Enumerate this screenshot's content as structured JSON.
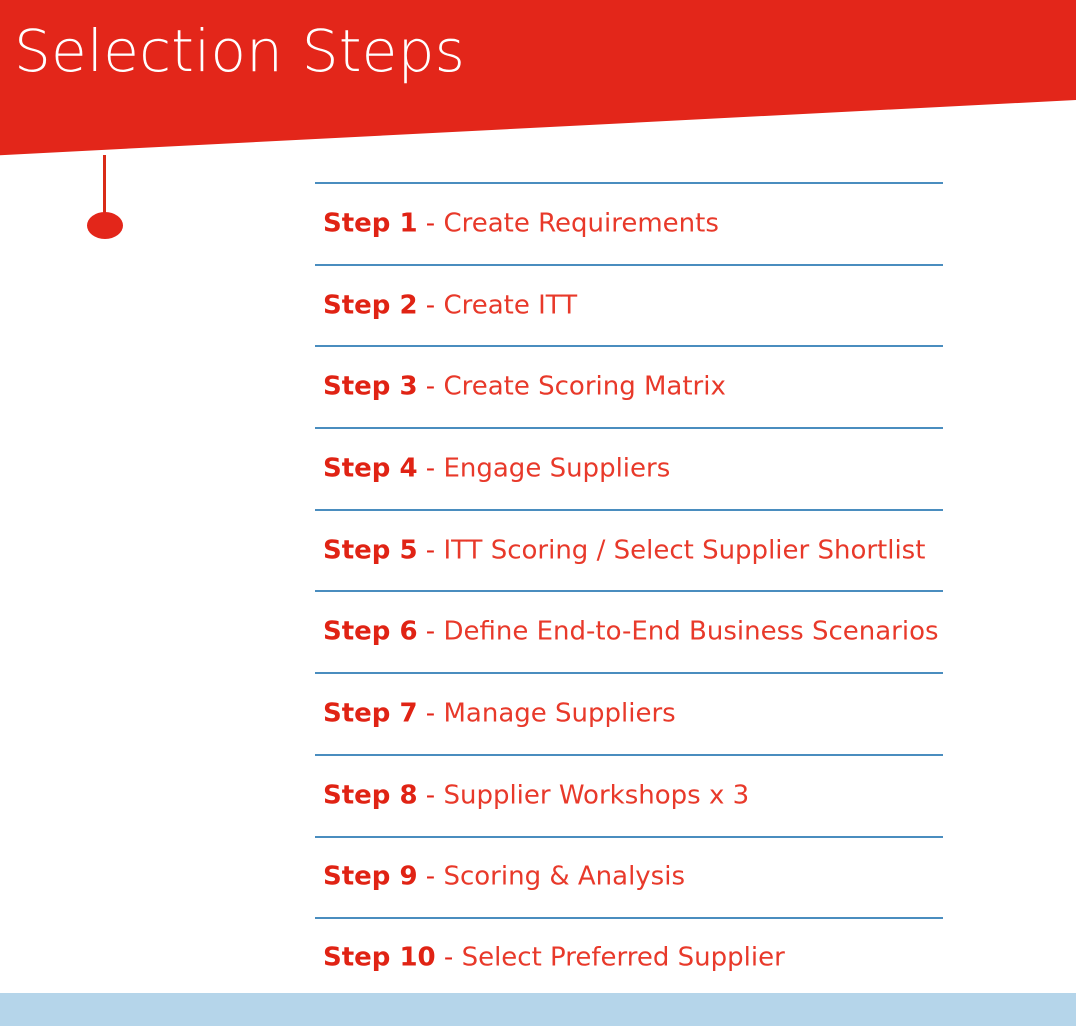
{
  "slide": {
    "title": "Selection Steps",
    "banner_color": "#E3261A",
    "title_color": "#FFFFFF",
    "footer_color": "#B5D5EA",
    "separator_color": "#4A8DBF",
    "step_text_color": "#E3261A"
  },
  "connector": {
    "stem_name": "connector-stem",
    "dot_name": "connector-dot"
  },
  "steps": [
    {
      "label": "Step 1",
      "sep": " - ",
      "desc": "Create Requirements"
    },
    {
      "label": "Step 2",
      "sep": " - ",
      "desc": "Create ITT"
    },
    {
      "label": "Step 3",
      "sep": " - ",
      "desc": "Create Scoring Matrix"
    },
    {
      "label": "Step 4",
      "sep": " - ",
      "desc": "Engage Suppliers"
    },
    {
      "label": "Step 5",
      "sep": " - ",
      "desc": "ITT Scoring / Select Supplier Shortlist"
    },
    {
      "label": "Step 6",
      "sep": " - ",
      "desc": "Define End-to-End Business Scenarios"
    },
    {
      "label": "Step 7",
      "sep": " - ",
      "desc": "Manage Suppliers"
    },
    {
      "label": "Step 8",
      "sep": " - ",
      "desc": "Supplier Workshops x 3"
    },
    {
      "label": "Step 9",
      "sep": " - ",
      "desc": "Scoring & Analysis"
    },
    {
      "label": "Step 10",
      "sep": " - ",
      "desc": "Select Preferred Supplier"
    }
  ]
}
